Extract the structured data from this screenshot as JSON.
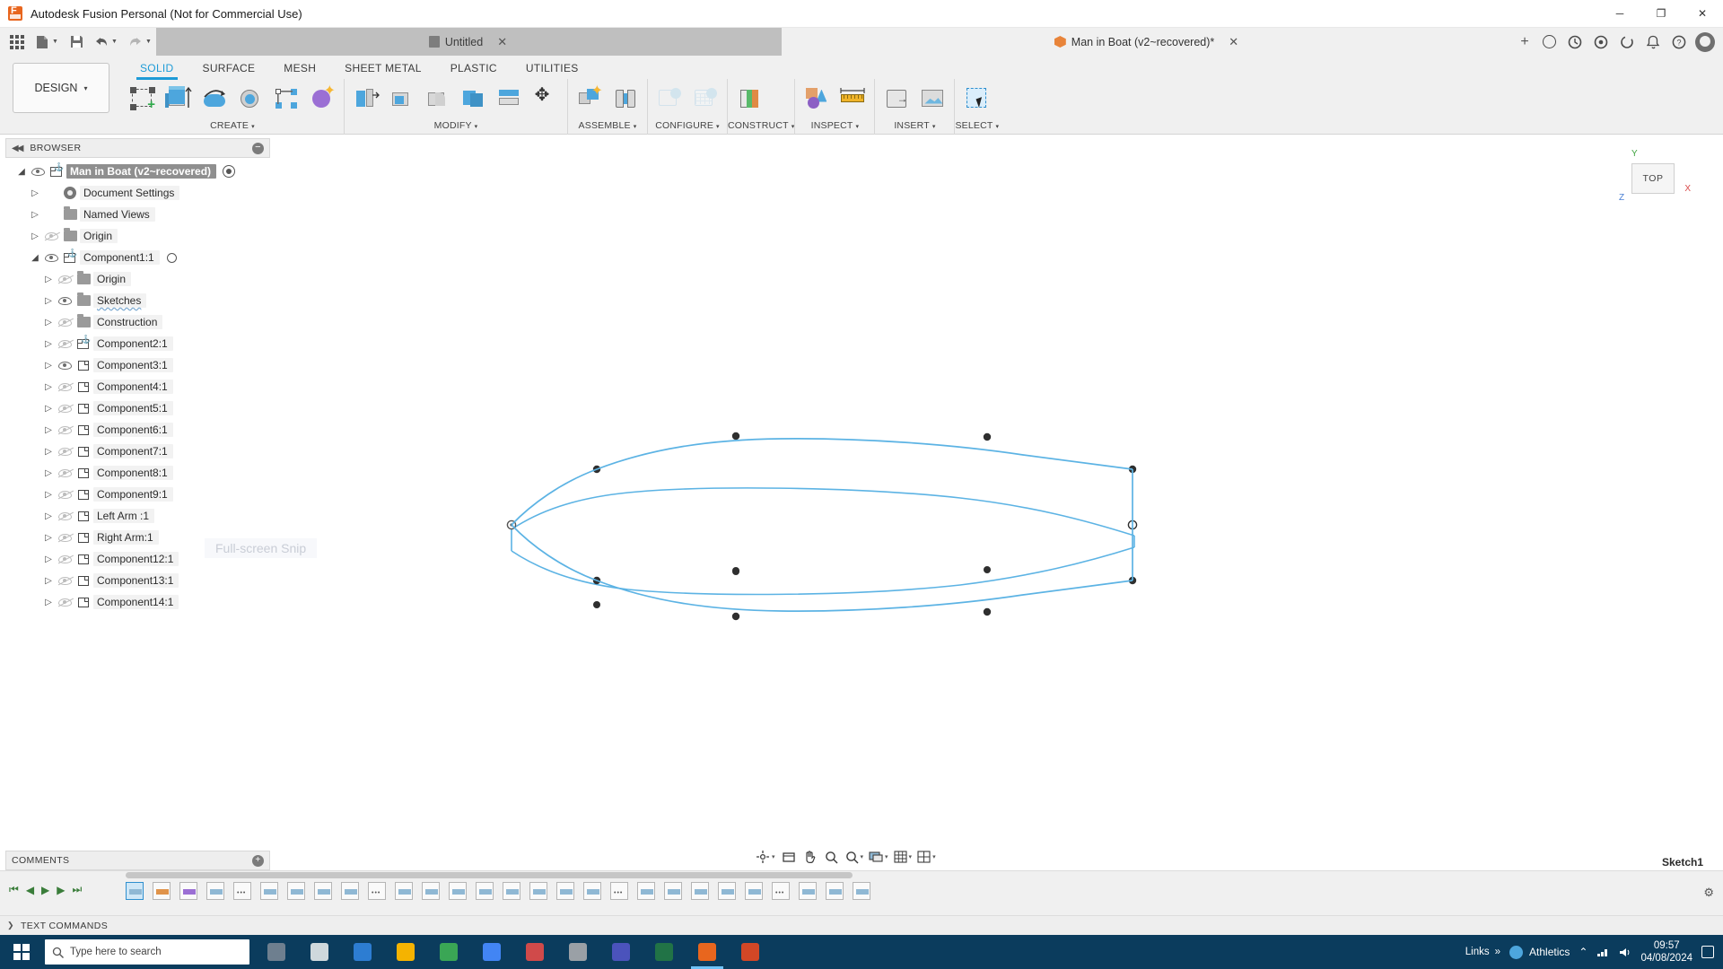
{
  "window": {
    "app_title": "Autodesk Fusion Personal (Not for Commercial Use)",
    "minimize": "─",
    "maximize": "❐",
    "close": "✕"
  },
  "quick_access": {
    "apps_grid": "apps-grid",
    "new_label": "New",
    "save_label": "Save",
    "undo_label": "Undo",
    "redo_label": "Redo"
  },
  "doc_tabs": [
    {
      "label": "Untitled",
      "icon": "document-icon",
      "active": false,
      "closable": true
    },
    {
      "label": "Man in Boat (v2~recovered)*",
      "icon": "cube-icon",
      "active": true,
      "closable": true
    }
  ],
  "tab_add": "+",
  "header_icons": [
    "globe-icon",
    "help-circle-icon",
    "job-status-icon",
    "extension-icon",
    "bell-icon",
    "question-icon",
    "avatar"
  ],
  "ribbon": {
    "workspace": "DESIGN",
    "workspace_caret": "▾",
    "tabs": [
      {
        "label": "SOLID",
        "selected": true
      },
      {
        "label": "SURFACE",
        "selected": false
      },
      {
        "label": "MESH",
        "selected": false
      },
      {
        "label": "SHEET METAL",
        "selected": false
      },
      {
        "label": "PLASTIC",
        "selected": false
      },
      {
        "label": "UTILITIES",
        "selected": false
      }
    ],
    "panels": [
      {
        "label": "CREATE",
        "caret": "▾",
        "buttons": [
          {
            "name": "create-sketch-button",
            "icon": "create-sketch-icon",
            "disabled": false
          },
          {
            "name": "extrude-button",
            "icon": "extrude-icon",
            "disabled": false
          },
          {
            "name": "revolve-button",
            "icon": "revolve-icon",
            "disabled": false
          },
          {
            "name": "sweep-button",
            "icon": "sweep-icon",
            "disabled": false
          },
          {
            "name": "rib-button",
            "icon": "pattern-icon",
            "disabled": false
          },
          {
            "name": "form-button",
            "icon": "create-form-icon",
            "disabled": false
          }
        ]
      },
      {
        "label": "MODIFY",
        "caret": "▾",
        "buttons": [
          {
            "name": "press-pull-button",
            "icon": "press-pull-icon",
            "disabled": false
          },
          {
            "name": "fillet-button",
            "icon": "fillet-icon",
            "disabled": false
          },
          {
            "name": "shell-button",
            "icon": "shell-icon",
            "disabled": false
          },
          {
            "name": "combine-button",
            "icon": "combine-icon",
            "disabled": false
          },
          {
            "name": "split-body-button",
            "icon": "split-body-icon",
            "disabled": false
          },
          {
            "name": "move-copy-button",
            "icon": "move-copy-icon",
            "disabled": false
          }
        ]
      },
      {
        "label": "ASSEMBLE",
        "caret": "▾",
        "buttons": [
          {
            "name": "new-component-button",
            "icon": "new-component-icon",
            "disabled": false
          },
          {
            "name": "joint-button",
            "icon": "joint-icon",
            "disabled": false
          }
        ]
      },
      {
        "label": "CONFIGURE",
        "caret": "▾",
        "buttons": [
          {
            "name": "create-configuration-button",
            "icon": "create-configuration-icon",
            "disabled": true
          },
          {
            "name": "configuration-table-button",
            "icon": "configuration-table-icon",
            "disabled": true
          }
        ]
      },
      {
        "label": "CONSTRUCT",
        "caret": "▾",
        "buttons": [
          {
            "name": "offset-plane-button",
            "icon": "offset-plane-icon",
            "disabled": false
          }
        ]
      },
      {
        "label": "INSPECT",
        "caret": "▾",
        "buttons": [
          {
            "name": "interference-button",
            "icon": "interference-icon",
            "disabled": false
          },
          {
            "name": "measure-button",
            "icon": "measure-ruler-icon",
            "disabled": false
          }
        ]
      },
      {
        "label": "INSERT",
        "caret": "▾",
        "buttons": [
          {
            "name": "derive-button",
            "icon": "derive-icon",
            "disabled": false
          },
          {
            "name": "insert-canvas-button",
            "icon": "insert-canvas-icon",
            "disabled": false
          }
        ]
      },
      {
        "label": "SELECT",
        "caret": "▾",
        "buttons": [
          {
            "name": "select-tool-button",
            "icon": "select-cursor-icon",
            "disabled": false
          }
        ]
      }
    ]
  },
  "browser": {
    "title": "BROWSER",
    "collapse_icon": "collapse-left-icon",
    "minimize_icon": "minus-circle-icon",
    "tree": [
      {
        "label": "Man in Boat (v2~recovered)",
        "indent": 0,
        "arrow": "open",
        "eye": "on",
        "icon": "document-root-icon",
        "root": true,
        "trailing": "radio-dot"
      },
      {
        "label": "Document Settings",
        "indent": 1,
        "arrow": "closed",
        "eye": "none",
        "icon": "gear-icon"
      },
      {
        "label": "Named Views",
        "indent": 1,
        "arrow": "closed",
        "eye": "none",
        "icon": "folder-icon"
      },
      {
        "label": "Origin",
        "indent": 1,
        "arrow": "closed",
        "eye": "off",
        "icon": "folder-icon"
      },
      {
        "label": "Component1:1",
        "indent": 1,
        "arrow": "open",
        "eye": "on",
        "icon": "component-icon",
        "trailing": "circle"
      },
      {
        "label": "Origin",
        "indent": 2,
        "arrow": "closed",
        "eye": "off",
        "icon": "folder-icon"
      },
      {
        "label": "Sketches",
        "indent": 2,
        "arrow": "closed",
        "eye": "on",
        "icon": "folder-icon",
        "spellmark": true
      },
      {
        "label": "Construction",
        "indent": 2,
        "arrow": "closed",
        "eye": "off",
        "icon": "folder-icon"
      },
      {
        "label": "Component2:1",
        "indent": 2,
        "arrow": "closed",
        "eye": "off",
        "icon": "component-icon"
      },
      {
        "label": "Component3:1",
        "indent": 2,
        "arrow": "closed",
        "eye": "on",
        "icon": "body-icon"
      },
      {
        "label": "Component4:1",
        "indent": 2,
        "arrow": "closed",
        "eye": "off",
        "icon": "body-icon"
      },
      {
        "label": "Component5:1",
        "indent": 2,
        "arrow": "closed",
        "eye": "off",
        "icon": "body-icon"
      },
      {
        "label": "Component6:1",
        "indent": 2,
        "arrow": "closed",
        "eye": "off",
        "icon": "body-icon"
      },
      {
        "label": "Component7:1",
        "indent": 2,
        "arrow": "closed",
        "eye": "off",
        "icon": "body-icon"
      },
      {
        "label": "Component8:1",
        "indent": 2,
        "arrow": "closed",
        "eye": "off",
        "icon": "body-icon"
      },
      {
        "label": "Component9:1",
        "indent": 2,
        "arrow": "closed",
        "eye": "off",
        "icon": "body-icon"
      },
      {
        "label": "Left Arm :1",
        "indent": 2,
        "arrow": "closed",
        "eye": "off",
        "icon": "body-icon"
      },
      {
        "label": "Right Arm:1",
        "indent": 2,
        "arrow": "closed",
        "eye": "off",
        "icon": "body-icon"
      },
      {
        "label": "Component12:1",
        "indent": 2,
        "arrow": "closed",
        "eye": "off",
        "icon": "body-icon"
      },
      {
        "label": "Component13:1",
        "indent": 2,
        "arrow": "closed",
        "eye": "off",
        "icon": "body-icon"
      },
      {
        "label": "Component14:1",
        "indent": 2,
        "arrow": "closed",
        "eye": "off",
        "icon": "body-icon"
      }
    ]
  },
  "canvas": {
    "watermark": "Full-screen Snip",
    "viewcube_face": "TOP",
    "axis_x": "X",
    "axis_y": "Y",
    "axis_z": "Z",
    "sketch_color": "#4da6dd",
    "point_color": "#333333"
  },
  "navbar": {
    "buttons": [
      {
        "name": "orbit-button",
        "icon": "orbit-icon",
        "caret": "▾"
      },
      {
        "name": "look-at-button",
        "icon": "look-at-icon",
        "caret": ""
      },
      {
        "name": "pan-button",
        "icon": "pan-hand-icon",
        "caret": ""
      },
      {
        "name": "zoom-button",
        "icon": "zoom-magnifier-icon",
        "caret": ""
      },
      {
        "name": "fit-button",
        "icon": "fit-icon",
        "caret": "▾"
      },
      {
        "name": "display-settings-button",
        "icon": "display-settings-icon",
        "caret": "▾"
      },
      {
        "name": "grid-snaps-button",
        "icon": "grid-snaps-icon",
        "caret": "▾"
      },
      {
        "name": "viewports-button",
        "icon": "viewports-icon",
        "caret": "▾"
      }
    ]
  },
  "comments": {
    "title": "COMMENTS",
    "add_icon": "plus-circle-icon"
  },
  "status": {
    "sketch_name": "Sketch1"
  },
  "timeline": {
    "playback": [
      {
        "name": "jump-start-button",
        "glyph": "⏮"
      },
      {
        "name": "step-back-button",
        "glyph": "◀"
      },
      {
        "name": "play-button",
        "glyph": "▶"
      },
      {
        "name": "step-forward-button",
        "glyph": "▶"
      },
      {
        "name": "jump-end-button",
        "glyph": "⏭"
      }
    ],
    "features": [
      {
        "name": "timeline-feature",
        "kind": "sketch",
        "selected": true
      },
      {
        "name": "timeline-feature",
        "kind": "orange",
        "selected": false
      },
      {
        "name": "timeline-feature",
        "kind": "purple",
        "selected": false
      },
      {
        "name": "timeline-feature",
        "kind": "plain",
        "selected": false
      },
      {
        "name": "timeline-feature",
        "kind": "dots",
        "selected": false
      },
      {
        "name": "timeline-feature",
        "kind": "plain",
        "selected": false
      },
      {
        "name": "timeline-feature",
        "kind": "plain",
        "selected": false
      },
      {
        "name": "timeline-feature",
        "kind": "plain",
        "selected": false
      },
      {
        "name": "timeline-feature",
        "kind": "plain",
        "selected": false
      },
      {
        "name": "timeline-feature",
        "kind": "dots",
        "selected": false
      },
      {
        "name": "timeline-feature",
        "kind": "plain",
        "selected": false
      },
      {
        "name": "timeline-feature",
        "kind": "plain",
        "selected": false
      },
      {
        "name": "timeline-feature",
        "kind": "plain",
        "selected": false
      },
      {
        "name": "timeline-feature",
        "kind": "plain",
        "selected": false
      },
      {
        "name": "timeline-feature",
        "kind": "plain",
        "selected": false
      },
      {
        "name": "timeline-feature",
        "kind": "plain",
        "selected": false
      },
      {
        "name": "timeline-feature",
        "kind": "plain",
        "selected": false
      },
      {
        "name": "timeline-feature",
        "kind": "plain",
        "selected": false
      },
      {
        "name": "timeline-feature",
        "kind": "dots",
        "selected": false
      },
      {
        "name": "timeline-feature",
        "kind": "plain",
        "selected": false
      },
      {
        "name": "timeline-feature",
        "kind": "plain",
        "selected": false
      },
      {
        "name": "timeline-feature",
        "kind": "plain",
        "selected": false
      },
      {
        "name": "timeline-feature",
        "kind": "plain",
        "selected": false
      },
      {
        "name": "timeline-feature",
        "kind": "plain",
        "selected": false
      },
      {
        "name": "timeline-feature",
        "kind": "dots",
        "selected": false
      },
      {
        "name": "timeline-feature",
        "kind": "plain",
        "selected": false
      },
      {
        "name": "timeline-feature",
        "kind": "plain",
        "selected": false
      },
      {
        "name": "timeline-feature",
        "kind": "plain",
        "selected": false
      }
    ],
    "settings_icon": "gear-icon"
  },
  "text_commands": {
    "title": "TEXT COMMANDS",
    "chevron": "❯"
  },
  "taskbar": {
    "search_placeholder": "Type here to search",
    "search_icon": "search-icon",
    "task_view_icon": "task-view-icon",
    "apps": [
      {
        "name": "taskbar-app-cortana",
        "color": "#6e7f8f"
      },
      {
        "name": "taskbar-app-taskview",
        "color": "#cfd8dc"
      },
      {
        "name": "taskbar-app-mail",
        "color": "#2d7dd2"
      },
      {
        "name": "taskbar-app-explorer",
        "color": "#f5b301"
      },
      {
        "name": "taskbar-app-media",
        "color": "#3aa655"
      },
      {
        "name": "taskbar-app-chrome",
        "color": "#4285f4"
      },
      {
        "name": "taskbar-app-paint",
        "color": "#d04a4a"
      },
      {
        "name": "taskbar-app-settings",
        "color": "#9aa0a6"
      },
      {
        "name": "taskbar-app-teams",
        "color": "#4b53bc"
      },
      {
        "name": "taskbar-app-excel",
        "color": "#217346"
      },
      {
        "name": "taskbar-app-fusion",
        "color": "#e8661e"
      },
      {
        "name": "taskbar-app-snip",
        "color": "#d24726"
      }
    ],
    "links_label": "Links",
    "links_chevron": "»",
    "weather": "Athletics",
    "tray_chevron": "⌃",
    "network_icon": "network-icon",
    "volume_icon": "volume-icon",
    "time": "09:57",
    "date": "04/08/2024",
    "notification_icon": "notification-icon"
  }
}
